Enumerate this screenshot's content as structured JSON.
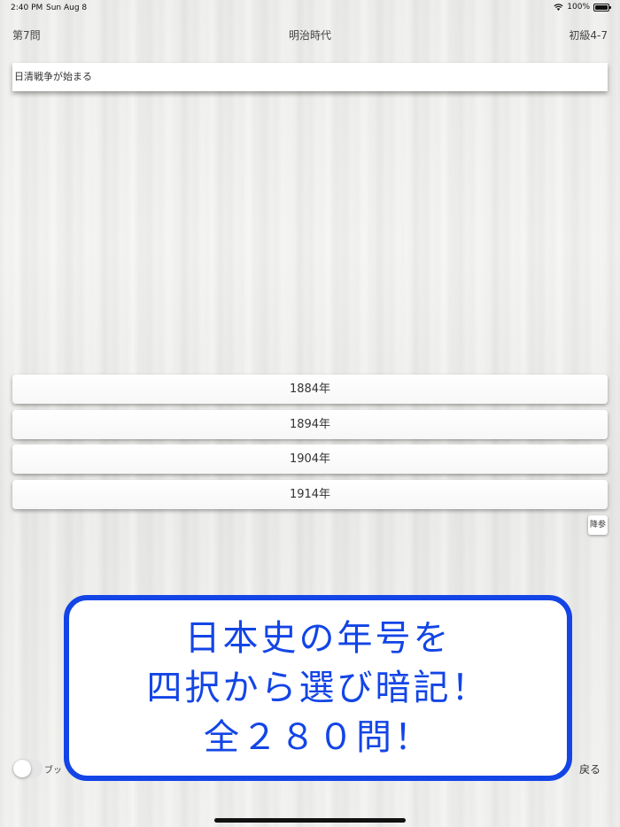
{
  "status_bar": {
    "time": "2:40 PM",
    "date": "Sun Aug 8",
    "battery": "100%"
  },
  "header": {
    "question_number": "第7問",
    "era": "明治時代",
    "level": "初級4-7"
  },
  "question": {
    "text": "日清戦争が始まる"
  },
  "choices": [
    "1884年",
    "1894年",
    "1904年",
    "1914年"
  ],
  "mini_button": "降参",
  "bookmark_toggle": {
    "label": "ブッ",
    "on": false
  },
  "back_button": "戻る",
  "promo": {
    "line1": "日本史の年号を",
    "line2": "四択から選び暗記！",
    "line3": "全２８０問！"
  },
  "colors": {
    "promo_blue": "#1345e6"
  }
}
